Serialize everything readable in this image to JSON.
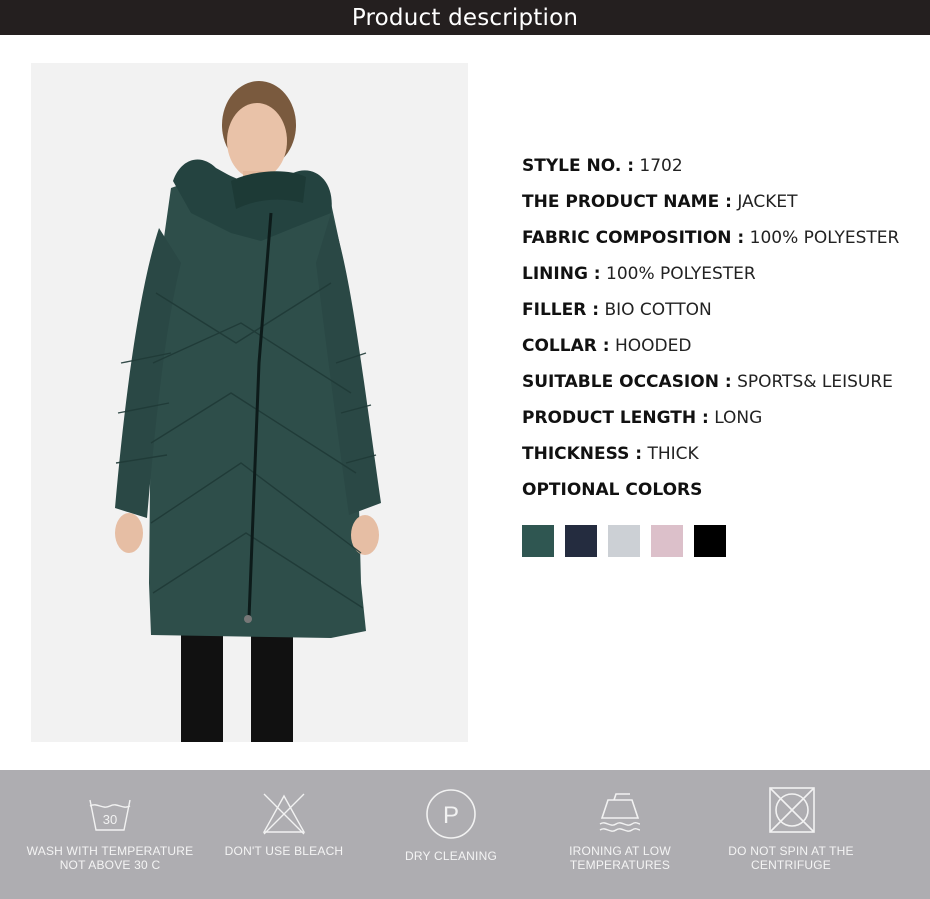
{
  "header": {
    "title": "Product description"
  },
  "product": {
    "image_alt": "woman wearing long dark green hooded quilted jacket",
    "specs": [
      {
        "label": "STYLE NO. :",
        "value": "1702"
      },
      {
        "label": "THE PRODUCT NAME :",
        "value": "JACKET"
      },
      {
        "label": "FABRIC COMPOSITION :",
        "value": "100% POLYESTER"
      },
      {
        "label": "LINING :",
        "value": "100% POLYESTER"
      },
      {
        "label": "FILLER :",
        "value": "BIO COTTON"
      },
      {
        "label": "COLLAR :",
        "value": "HOODED"
      },
      {
        "label": "SUITABLE OCCASION :",
        "value": "SPORTS& LEISURE"
      },
      {
        "label": "PRODUCT LENGTH :",
        "value": "LONG"
      },
      {
        "label": "THICKNESS :",
        "value": "THICK"
      },
      {
        "label": "OPTIONAL COLORS",
        "value": ""
      }
    ],
    "colors": [
      "#2f5651",
      "#242c3f",
      "#ccd0d5",
      "#dcc0ca",
      "#000000"
    ]
  },
  "care": [
    {
      "icon": "wash-30-icon",
      "lines": [
        "WASH WITH TEMPERATURE",
        "NOT ABOVE 30 C"
      ],
      "badge": "30"
    },
    {
      "icon": "no-bleach-icon",
      "lines": [
        "DON'T USE BLEACH",
        ""
      ]
    },
    {
      "icon": "dry-clean-icon",
      "lines": [
        "DRY CLEANING",
        ""
      ],
      "badge": "P"
    },
    {
      "icon": "iron-low-icon",
      "lines": [
        "IRONING AT LOW",
        "TEMPERATURES"
      ]
    },
    {
      "icon": "no-spin-icon",
      "lines": [
        "DO NOT SPIN AT THE",
        "CENTRIFUGE"
      ]
    }
  ]
}
